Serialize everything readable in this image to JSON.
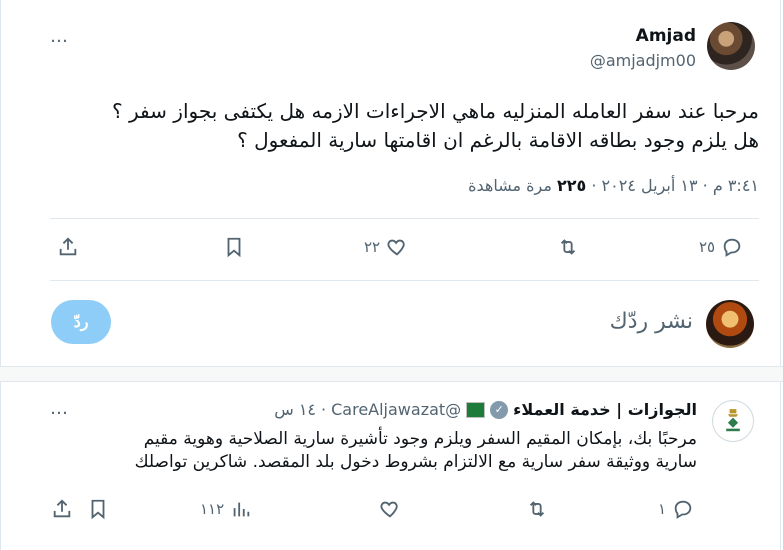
{
  "tweet": {
    "author_name": "Amjad",
    "author_handle": "@amjadjm00",
    "text_line1": "مرحبا عند سفر العامله المنزليه ماهي الاجراءات الازمه هل يكتفى بجواز سفر ؟",
    "text_line2": "هل يلزم وجود بطاقه الاقامة بالرغم ان اقامتها سارية المفعول ؟",
    "time_text": "٣:٤١ م · ١٣ أبريل ٢٠٢٤ · ",
    "views_count": "٢٢٥",
    "views_label": " مرة مشاهدة",
    "more_icon": "…",
    "reply_count": "٢٥",
    "retweet_count": "",
    "like_count": "٢٢",
    "bookmark_count": ""
  },
  "composer": {
    "placeholder": "نشر ردّك",
    "button_label": "ردّ"
  },
  "reply": {
    "author_name": "الجوازات | خدمة العملاء",
    "author_handle": "@CareAljawazat",
    "time": "١٤ س",
    "verified_icon": "verified-badge-icon",
    "text_line1": "مرحبًا بك، بإمكان المقيم السفر ويلزم وجود تأشيرة سارية الصلاحية وهوية مقيم",
    "text_line2": "سارية ووثيقة سفر سارية مع الالتزام بشروط دخول بلد المقصد. شاكرين تواصلك",
    "reply_count": "١",
    "like_count": "",
    "views_count": "١١٢"
  },
  "colors": {
    "accent": "#1d9bf0",
    "reply_button": "#8ecdf8",
    "secondary_text": "#536471",
    "divider": "#e1e8ed"
  }
}
